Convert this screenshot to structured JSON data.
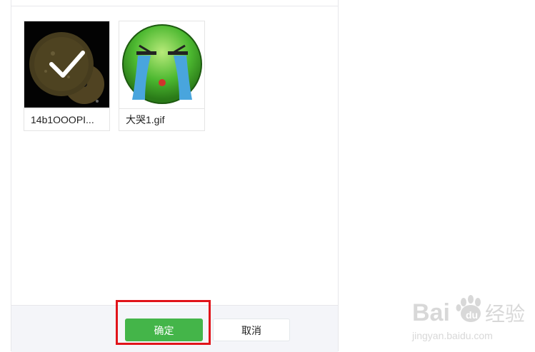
{
  "images": [
    {
      "filename": "14b1OOOPI...",
      "selected": true,
      "icon": "check-icon"
    },
    {
      "filename": "大哭1.gif",
      "selected": false
    }
  ],
  "footer": {
    "confirm_label": "确定",
    "cancel_label": "取消"
  },
  "watermark": {
    "brand": "Bai 经验",
    "url": "jingyan.baidu.com"
  },
  "colors": {
    "confirm_green": "#44b549",
    "highlight_red": "#e1141a",
    "footer_bg": "#f4f5f9"
  }
}
